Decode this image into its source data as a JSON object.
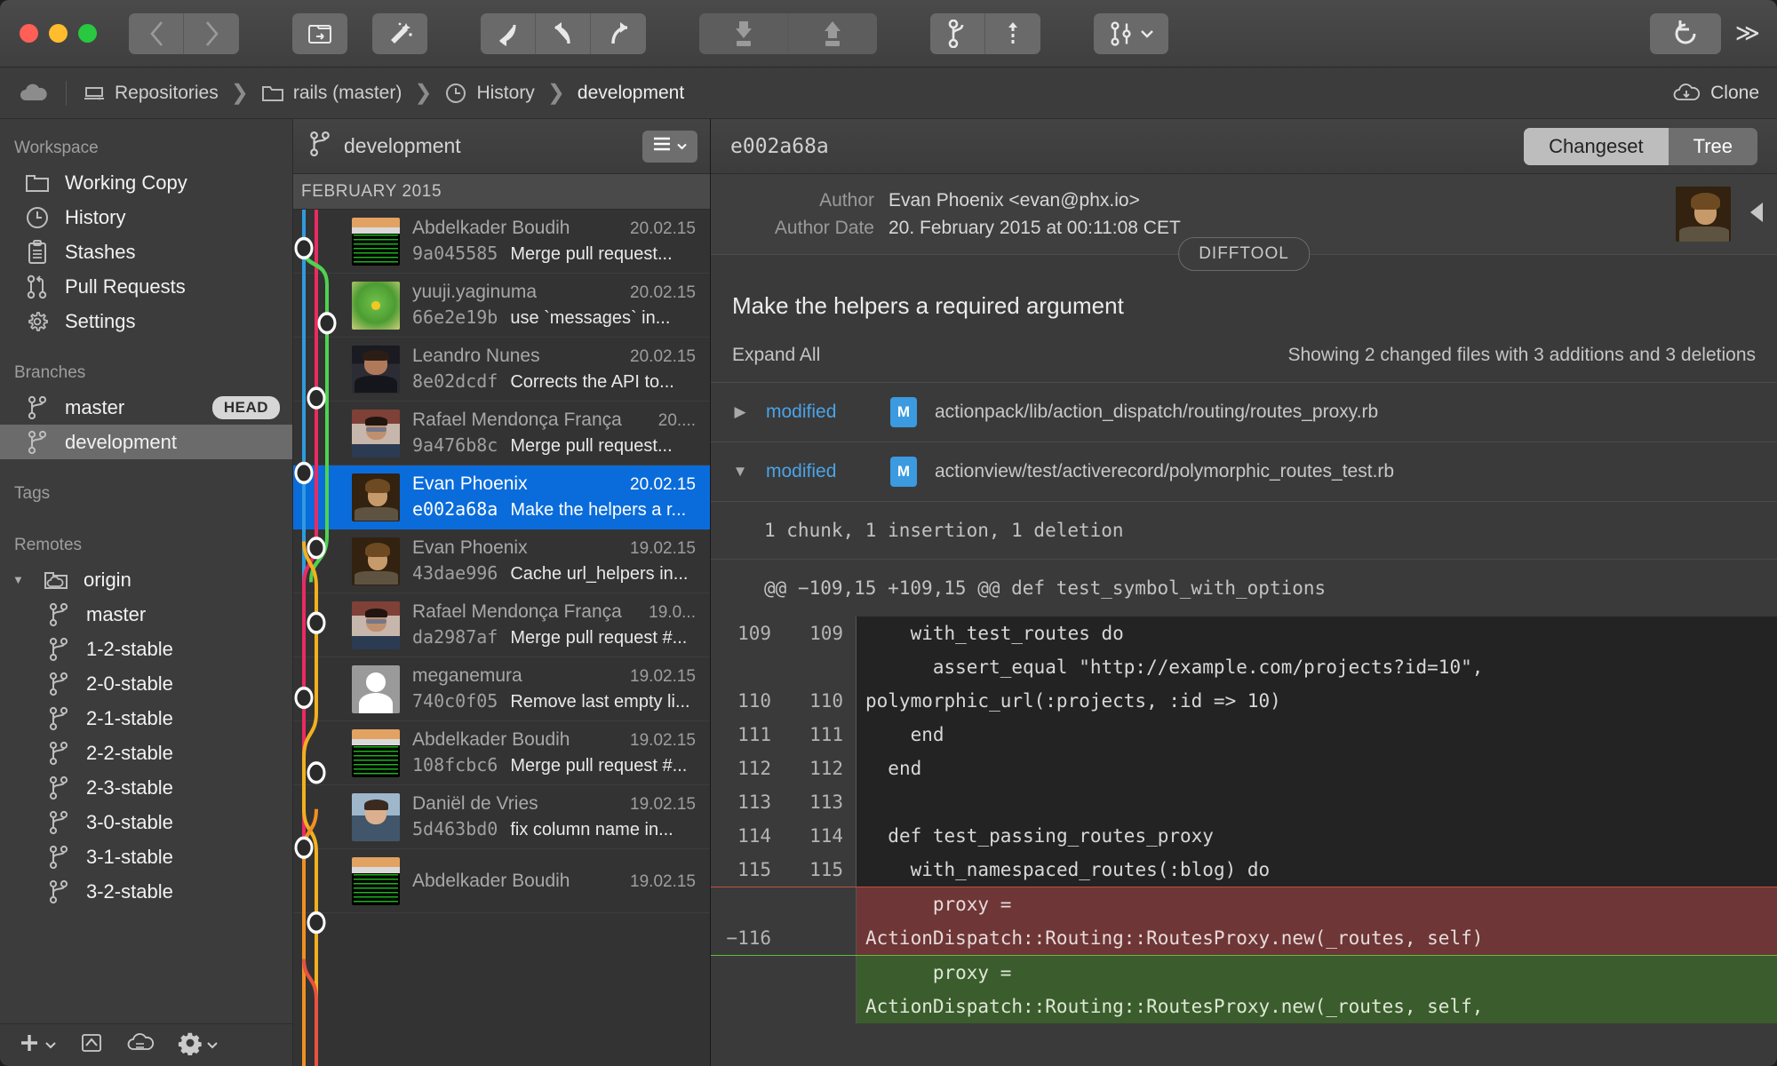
{
  "titlebar": {
    "traffic": [
      "close",
      "minimize",
      "zoom"
    ],
    "buttons": [
      {
        "name": "back-button",
        "icon": "chevron-left-icon"
      },
      {
        "name": "forward-button",
        "icon": "chevron-right-icon"
      },
      {
        "name": "open-repository-button",
        "icon": "folder-open-icon"
      },
      {
        "name": "quick-actions-button",
        "icon": "magic-wand-icon"
      },
      {
        "name": "discard-button",
        "icon": "discard-arrow-icon"
      },
      {
        "name": "checkout-button",
        "icon": "arrow-up-left-icon"
      },
      {
        "name": "push-changes-button",
        "icon": "arrow-up-right-icon"
      },
      {
        "name": "pull-button",
        "icon": "pull-down-icon"
      },
      {
        "name": "push-button",
        "icon": "push-up-icon"
      },
      {
        "name": "branch-button",
        "icon": "branch-icon"
      },
      {
        "name": "tag-button",
        "icon": "tag-line-icon"
      },
      {
        "name": "merge-button",
        "icon": "merge-icon"
      },
      {
        "name": "refresh-button",
        "icon": "refresh-icon"
      }
    ],
    "overflow_label": "≫"
  },
  "breadcrumb": {
    "cloud_icon": "cloud-icon",
    "items": [
      {
        "label": "Repositories",
        "icon": "server-icon"
      },
      {
        "label": "rails (master)",
        "icon": "folder-icon"
      },
      {
        "label": "History",
        "icon": "clock-icon"
      },
      {
        "label": "development",
        "icon": ""
      }
    ],
    "separator": "❯",
    "clone_label": "Clone",
    "clone_icon": "cloud-download-icon"
  },
  "sidebar": {
    "sections": [
      {
        "heading": "Workspace",
        "items": [
          {
            "label": "Working Copy",
            "icon": "folder-icon",
            "selected": false
          },
          {
            "label": "History",
            "icon": "clock-icon",
            "selected": false
          },
          {
            "label": "Stashes",
            "icon": "clipboard-icon",
            "selected": false
          },
          {
            "label": "Pull Requests",
            "icon": "pull-request-icon",
            "selected": false
          },
          {
            "label": "Settings",
            "icon": "gear-icon",
            "selected": false
          }
        ]
      },
      {
        "heading": "Branches",
        "items": [
          {
            "label": "master",
            "icon": "branch-icon",
            "selected": false,
            "badge": "HEAD"
          },
          {
            "label": "development",
            "icon": "branch-icon",
            "selected": true
          }
        ]
      },
      {
        "heading": "Tags",
        "items": []
      },
      {
        "heading": "Remotes",
        "items": [
          {
            "label": "origin",
            "icon": "remote-folder-icon",
            "selected": false,
            "disclosure": "▼"
          },
          {
            "label": "master",
            "icon": "branch-icon",
            "selected": false,
            "indent": true
          },
          {
            "label": "1-2-stable",
            "icon": "branch-icon",
            "selected": false,
            "indent": true
          },
          {
            "label": "2-0-stable",
            "icon": "branch-icon",
            "selected": false,
            "indent": true
          },
          {
            "label": "2-1-stable",
            "icon": "branch-icon",
            "selected": false,
            "indent": true
          },
          {
            "label": "2-2-stable",
            "icon": "branch-icon",
            "selected": false,
            "indent": true
          },
          {
            "label": "2-3-stable",
            "icon": "branch-icon",
            "selected": false,
            "indent": true
          },
          {
            "label": "3-0-stable",
            "icon": "branch-icon",
            "selected": false,
            "indent": true
          },
          {
            "label": "3-1-stable",
            "icon": "branch-icon",
            "selected": false,
            "indent": true
          },
          {
            "label": "3-2-stable",
            "icon": "branch-icon",
            "selected": false,
            "indent": true
          }
        ]
      }
    ],
    "toolbar": [
      {
        "name": "add-button",
        "icon": "plus-icon",
        "caret": true
      },
      {
        "name": "export-button",
        "icon": "share-up-icon",
        "caret": false
      },
      {
        "name": "cloud-services-button",
        "icon": "cloud-icon",
        "caret": false
      },
      {
        "name": "settings-button",
        "icon": "gear-icon",
        "caret": true
      }
    ]
  },
  "commit_list": {
    "branch_title": "development",
    "branch_icon": "branch-icon",
    "view_options_icon": "list-lines-icon",
    "month_header": "FEBRUARY 2015",
    "commits": [
      {
        "author": "Abdelkader Boudih",
        "date": "20.02.15",
        "hash": "9a045585",
        "message": "Merge pull request...",
        "avatar": "terminal",
        "selected": false
      },
      {
        "author": "yuuji.yaginuma",
        "date": "20.02.15",
        "hash": "66e2e19b",
        "message": "use `messages` in...",
        "avatar": "green",
        "selected": false
      },
      {
        "author": "Leandro Nunes",
        "date": "20.02.15",
        "hash": "8e02dcdf",
        "message": "Corrects the API to...",
        "avatar": "leandro",
        "selected": false
      },
      {
        "author": "Rafael Mendonça França",
        "date": "20....",
        "hash": "9a476b8c",
        "message": "Merge pull request...",
        "avatar": "rafael",
        "selected": false
      },
      {
        "author": "Evan Phoenix",
        "date": "20.02.15",
        "hash": "e002a68a",
        "message": "Make the helpers a r...",
        "avatar": "evan",
        "selected": true
      },
      {
        "author": "Evan Phoenix",
        "date": "19.02.15",
        "hash": "43dae996",
        "message": "Cache url_helpers in...",
        "avatar": "evan",
        "selected": false
      },
      {
        "author": "Rafael Mendonça França",
        "date": "19.0...",
        "hash": "da2987af",
        "message": "Merge pull request #...",
        "avatar": "rafael",
        "selected": false
      },
      {
        "author": "meganemura",
        "date": "19.02.15",
        "hash": "740c0f05",
        "message": "Remove last empty li...",
        "avatar": "anon",
        "selected": false
      },
      {
        "author": "Abdelkader Boudih",
        "date": "19.02.15",
        "hash": "108fcbc6",
        "message": "Merge pull request #...",
        "avatar": "terminal",
        "selected": false
      },
      {
        "author": "Daniël de Vries",
        "date": "19.02.15",
        "hash": "5d463bd0",
        "message": "fix column name in...",
        "avatar": "daniel",
        "selected": false
      },
      {
        "author": "Abdelkader Boudih",
        "date": "19.02.15",
        "hash": "",
        "message": "",
        "avatar": "terminal",
        "selected": false
      }
    ]
  },
  "detail": {
    "sha": "e002a68a",
    "segmented": [
      {
        "label": "Changeset",
        "active": true
      },
      {
        "label": "Tree",
        "active": false
      }
    ],
    "meta": [
      {
        "label": "Author",
        "value": "Evan Phoenix <evan@phx.io>"
      },
      {
        "label": "Author Date",
        "value": "20. February 2015 at 00:11:08 CET"
      }
    ],
    "difftool_label": "DIFFTOOL",
    "collapse_arrow_icon": "triangle-left-icon",
    "subject": "Make the helpers a required argument",
    "expand_all_label": "Expand All",
    "showing_label": "Showing 2 changed files with 3 additions and 3 deletions",
    "files": [
      {
        "state": "modified",
        "badge": "M",
        "path": "actionpack/lib/action_dispatch/routing/routes_proxy.rb",
        "expanded": false,
        "triangle": "▶"
      },
      {
        "state": "modified",
        "badge": "M",
        "path": "actionview/test/activerecord/polymorphic_routes_test.rb",
        "expanded": true,
        "triangle": "▼"
      }
    ],
    "chunk_summary": "1 chunk, 1 insertion, 1 deletion",
    "hunk_header": "@@ −109,15 +109,15 @@ def test_symbol_with_options",
    "diff_lines": [
      {
        "old": "109",
        "new": "109",
        "type": "ctx",
        "code": "    with_test_routes do"
      },
      {
        "old": "",
        "new": "",
        "type": "ctx",
        "code": "      assert_equal \"http://example.com/projects?id=10\","
      },
      {
        "old": "110",
        "new": "110",
        "type": "ctx",
        "code": "polymorphic_url(:projects, :id => 10)"
      },
      {
        "old": "111",
        "new": "111",
        "type": "ctx",
        "code": "    end"
      },
      {
        "old": "112",
        "new": "112",
        "type": "ctx",
        "code": "  end"
      },
      {
        "old": "113",
        "new": "113",
        "type": "ctx",
        "code": ""
      },
      {
        "old": "114",
        "new": "114",
        "type": "ctx",
        "code": "  def test_passing_routes_proxy"
      },
      {
        "old": "115",
        "new": "115",
        "type": "ctx",
        "code": "    with_namespaced_routes(:blog) do"
      },
      {
        "old": "",
        "new": "",
        "type": "del",
        "code": "      proxy ="
      },
      {
        "old": "−116",
        "new": "",
        "type": "del",
        "code": "ActionDispatch::Routing::RoutesProxy.new(_routes, self)"
      },
      {
        "old": "",
        "new": "",
        "type": "add",
        "code": "      proxy ="
      },
      {
        "old": "",
        "new": "",
        "type": "add",
        "code": "ActionDispatch::Routing::RoutesProxy.new(_routes, self,"
      }
    ]
  },
  "colors": {
    "selection_blue": "#0a6cdb",
    "accent_blue": "#3b9ae0",
    "add_green": "#3b5c2c",
    "del_red": "#6e3636",
    "graph_blue": "#2f9be0",
    "graph_pink": "#ec2a62",
    "graph_green": "#4fd24f",
    "graph_yellow": "#f2b01e",
    "graph_orange": "#f09020"
  }
}
